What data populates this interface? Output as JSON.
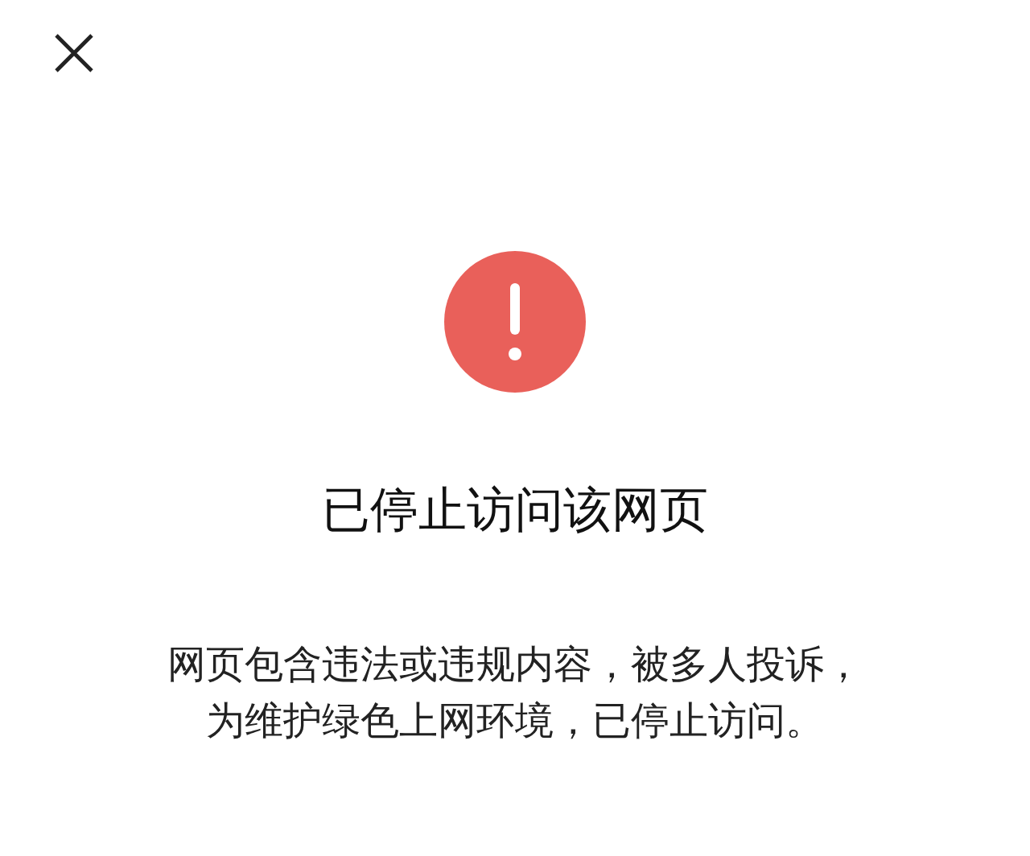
{
  "title": "已停止访问该网页",
  "message": "网页包含违法或违规内容，被多人投诉，为维护绿色上网环境，已停止访问。"
}
